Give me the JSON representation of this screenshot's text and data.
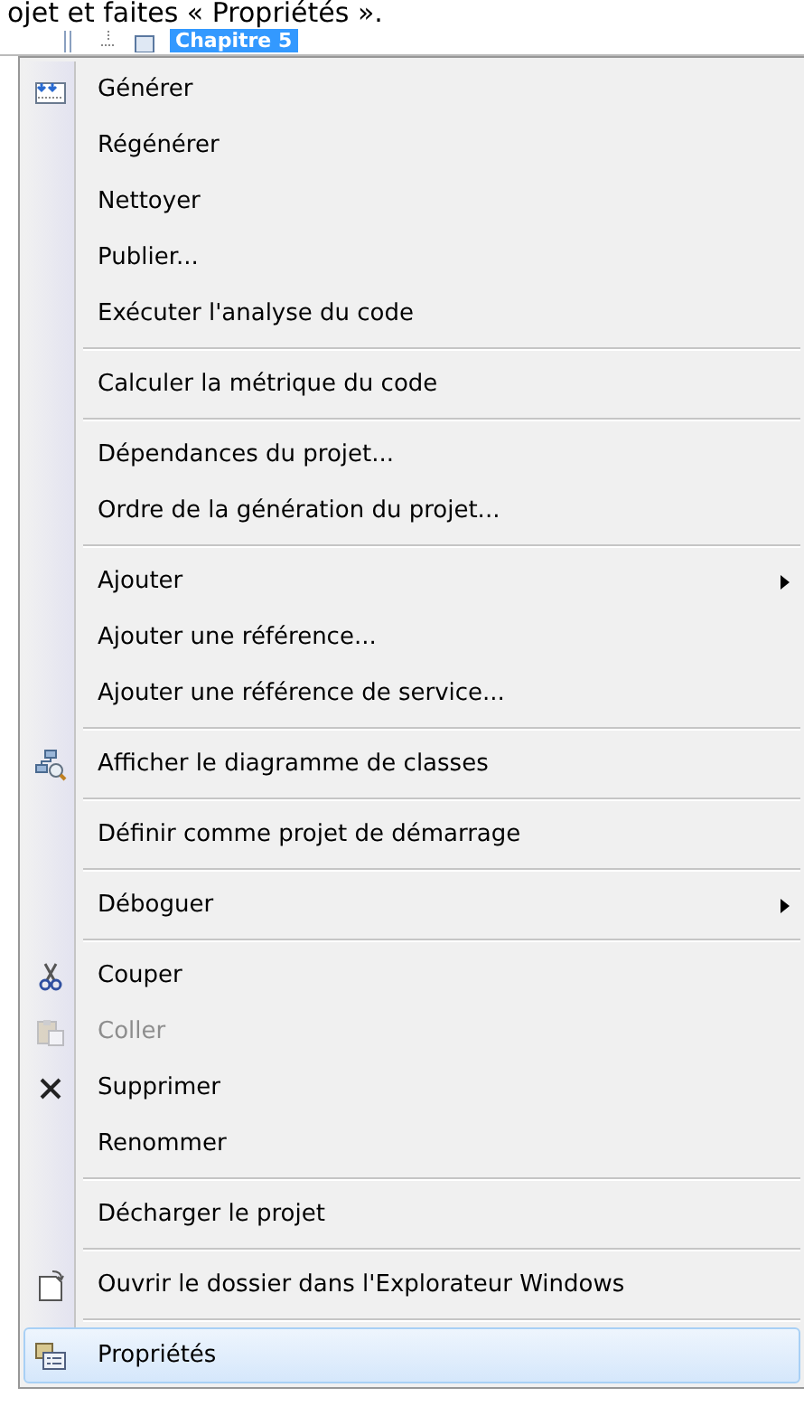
{
  "caption": "ojet et faites « Propriétés ».",
  "toolbar": {
    "tab": "Chapitre 5"
  },
  "menu": [
    {
      "kind": "item",
      "label": "Générer",
      "disabled": false,
      "submenu": false,
      "selected": false
    },
    {
      "kind": "item",
      "label": "Régénérer",
      "disabled": false,
      "submenu": false,
      "selected": false
    },
    {
      "kind": "item",
      "label": "Nettoyer",
      "disabled": false,
      "submenu": false,
      "selected": false
    },
    {
      "kind": "item",
      "label": "Publier...",
      "disabled": false,
      "submenu": false,
      "selected": false
    },
    {
      "kind": "item",
      "label": "Exécuter l'analyse du code",
      "disabled": false,
      "submenu": false,
      "selected": false
    },
    {
      "kind": "separator"
    },
    {
      "kind": "item",
      "label": "Calculer la métrique du code",
      "disabled": false,
      "submenu": false,
      "selected": false
    },
    {
      "kind": "separator"
    },
    {
      "kind": "item",
      "label": "Dépendances du projet...",
      "disabled": false,
      "submenu": false,
      "selected": false
    },
    {
      "kind": "item",
      "label": "Ordre de la génération du projet...",
      "disabled": false,
      "submenu": false,
      "selected": false
    },
    {
      "kind": "separator"
    },
    {
      "kind": "item",
      "label": "Ajouter",
      "disabled": false,
      "submenu": true,
      "selected": false
    },
    {
      "kind": "item",
      "label": "Ajouter une référence...",
      "disabled": false,
      "submenu": false,
      "selected": false
    },
    {
      "kind": "item",
      "label": "Ajouter une référence de service...",
      "disabled": false,
      "submenu": false,
      "selected": false
    },
    {
      "kind": "separator"
    },
    {
      "kind": "item",
      "label": "Afficher le diagramme de classes",
      "disabled": false,
      "submenu": false,
      "selected": false
    },
    {
      "kind": "separator"
    },
    {
      "kind": "item",
      "label": "Définir comme projet de démarrage",
      "disabled": false,
      "submenu": false,
      "selected": false
    },
    {
      "kind": "separator"
    },
    {
      "kind": "item",
      "label": "Déboguer",
      "disabled": false,
      "submenu": true,
      "selected": false
    },
    {
      "kind": "separator"
    },
    {
      "kind": "item",
      "label": "Couper",
      "disabled": false,
      "submenu": false,
      "selected": false
    },
    {
      "kind": "item",
      "label": "Coller",
      "disabled": true,
      "submenu": false,
      "selected": false
    },
    {
      "kind": "item",
      "label": "Supprimer",
      "disabled": false,
      "submenu": false,
      "selected": false
    },
    {
      "kind": "item",
      "label": "Renommer",
      "disabled": false,
      "submenu": false,
      "selected": false
    },
    {
      "kind": "separator"
    },
    {
      "kind": "item",
      "label": "Décharger le projet",
      "disabled": false,
      "submenu": false,
      "selected": false
    },
    {
      "kind": "separator"
    },
    {
      "kind": "item",
      "label": "Ouvrir le dossier dans l'Explorateur Windows",
      "disabled": false,
      "submenu": false,
      "selected": false
    },
    {
      "kind": "separator"
    },
    {
      "kind": "item",
      "label": "Propriétés",
      "disabled": false,
      "submenu": false,
      "selected": true
    }
  ]
}
